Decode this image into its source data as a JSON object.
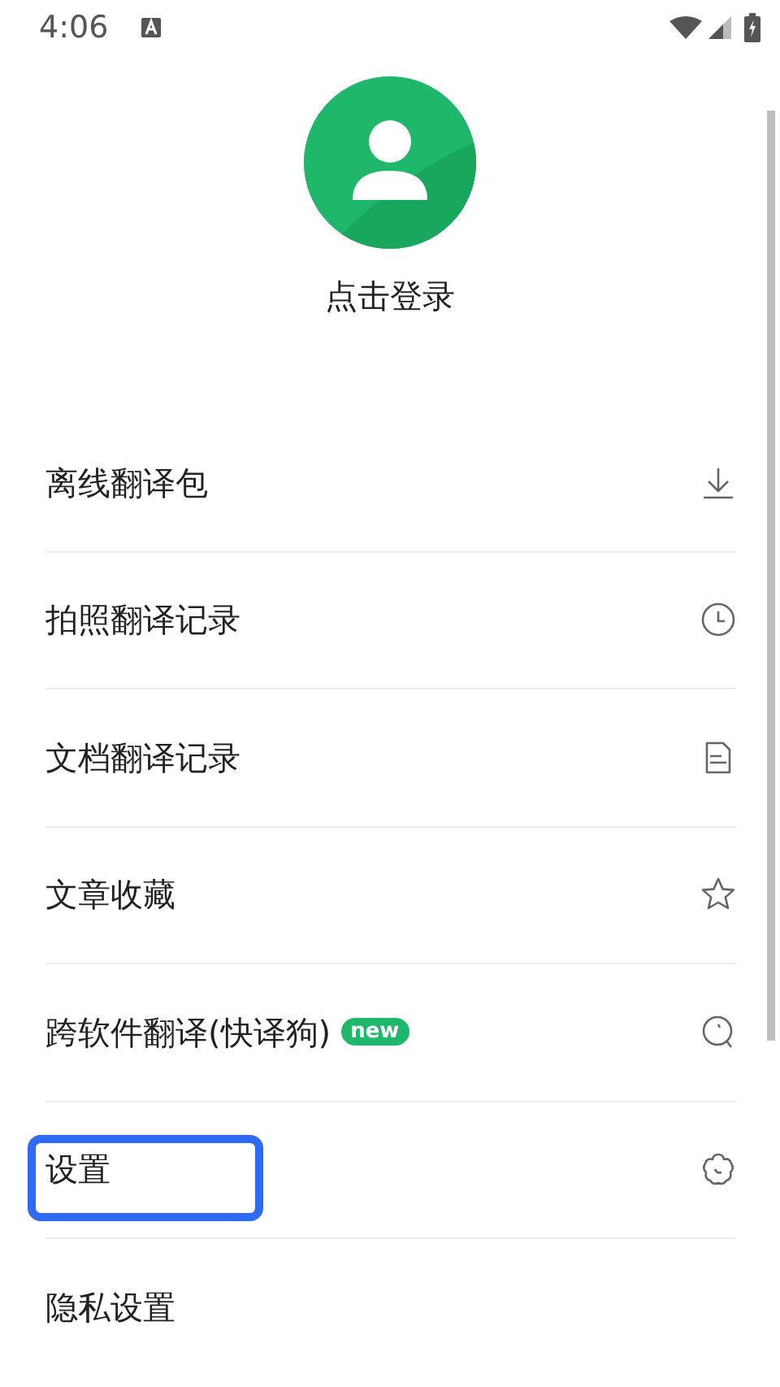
{
  "status_bar": {
    "time": "4:06"
  },
  "profile": {
    "login_label": "点击登录"
  },
  "menu": [
    {
      "label": "离线翻译包",
      "kind": "download",
      "highlighted": false
    },
    {
      "label": "拍照翻译记录",
      "kind": "clock",
      "highlighted": false
    },
    {
      "label": "文档翻译记录",
      "kind": "document",
      "highlighted": false
    },
    {
      "label": "文章收藏",
      "kind": "star",
      "highlighted": false
    },
    {
      "label": "跨软件翻译(快译狗)",
      "badge": "new",
      "kind": "magnifier",
      "highlighted": false
    },
    {
      "label": "设置",
      "kind": "flower",
      "highlighted": true
    },
    {
      "label": "隐私设置",
      "highlighted": false
    }
  ]
}
